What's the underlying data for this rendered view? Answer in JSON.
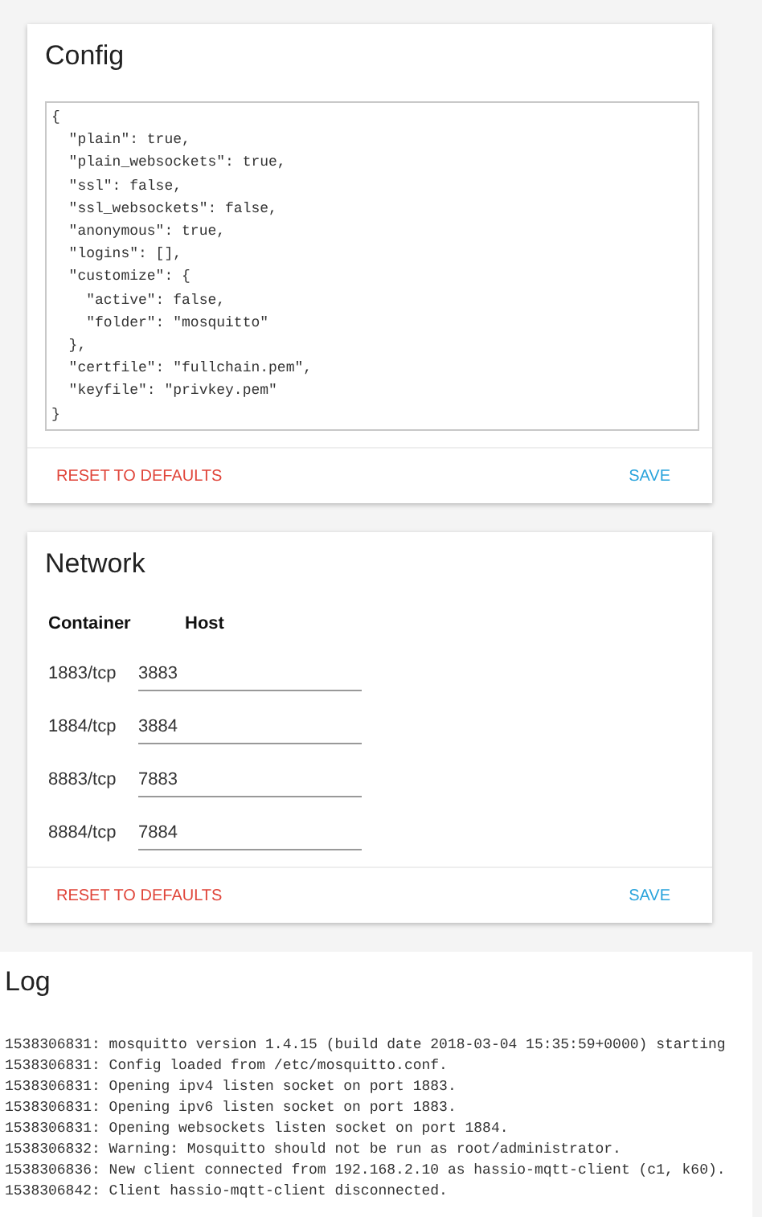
{
  "config": {
    "title": "Config",
    "editor_value": "{\n  \"plain\": true,\n  \"plain_websockets\": true,\n  \"ssl\": false,\n  \"ssl_websockets\": false,\n  \"anonymous\": true,\n  \"logins\": [],\n  \"customize\": {\n    \"active\": false,\n    \"folder\": \"mosquitto\"\n  },\n  \"certfile\": \"fullchain.pem\",\n  \"keyfile\": \"privkey.pem\"\n}",
    "reset_button": "RESET TO DEFAULTS",
    "save_button": "SAVE"
  },
  "network": {
    "title": "Network",
    "columns": [
      "Container",
      "Host"
    ],
    "rows": [
      {
        "container": "1883/tcp",
        "host": "3883"
      },
      {
        "container": "1884/tcp",
        "host": "3884"
      },
      {
        "container": "8883/tcp",
        "host": "7883"
      },
      {
        "container": "8884/tcp",
        "host": "7884"
      }
    ],
    "reset_button": "RESET TO DEFAULTS",
    "save_button": "SAVE"
  },
  "log": {
    "title": "Log",
    "lines": [
      "1538306831: mosquitto version 1.4.15 (build date 2018-03-04 15:35:59+0000) starting",
      "1538306831: Config loaded from /etc/mosquitto.conf.",
      "1538306831: Opening ipv4 listen socket on port 1883.",
      "1538306831: Opening ipv6 listen socket on port 1883.",
      "1538306831: Opening websockets listen socket on port 1884.",
      "1538306832: Warning: Mosquitto should not be run as root/administrator.",
      "1538306836: New client connected from 192.168.2.10 as hassio-mqtt-client (c1, k60).",
      "1538306842: Client hassio-mqtt-client disconnected."
    ]
  }
}
